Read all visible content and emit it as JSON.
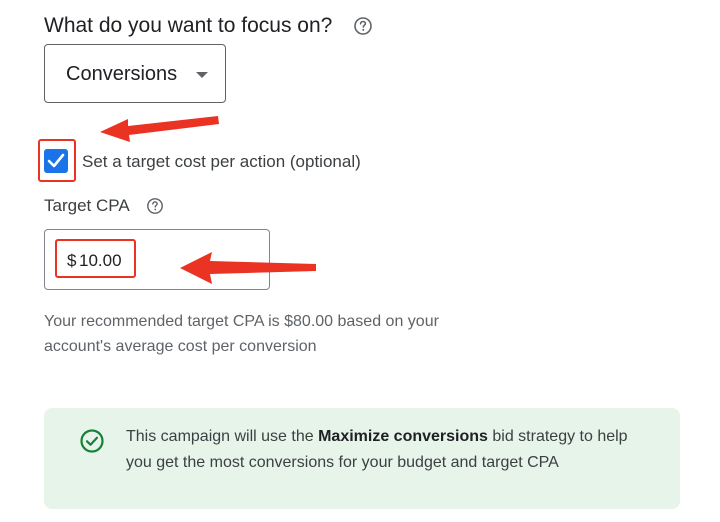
{
  "focus": {
    "title": "What do you want to focus on?",
    "help_icon": "help-circle-icon",
    "dropdown_value": "Conversions"
  },
  "target_cpa_toggle": {
    "checked": true,
    "label": "Set a target cost per action (optional)"
  },
  "target_cpa": {
    "label": "Target CPA",
    "help_icon": "help-circle-icon",
    "currency_symbol": "$",
    "value": "10.00",
    "recommendation_line1": "Your recommended target CPA is $80.00 based on your",
    "recommendation_line2": "account's average cost per conversion"
  },
  "info_banner": {
    "icon": "check-circle-icon",
    "text_before": "This campaign will use the ",
    "text_bold": "Maximize conversions",
    "text_after": " bid strategy to help you get the most conversions for your budget and target CPA"
  },
  "colors": {
    "accent": "#1a73e8",
    "annotation_red": "#ea3323",
    "success_green": "#188038",
    "banner_bg": "#e6f4ea"
  }
}
